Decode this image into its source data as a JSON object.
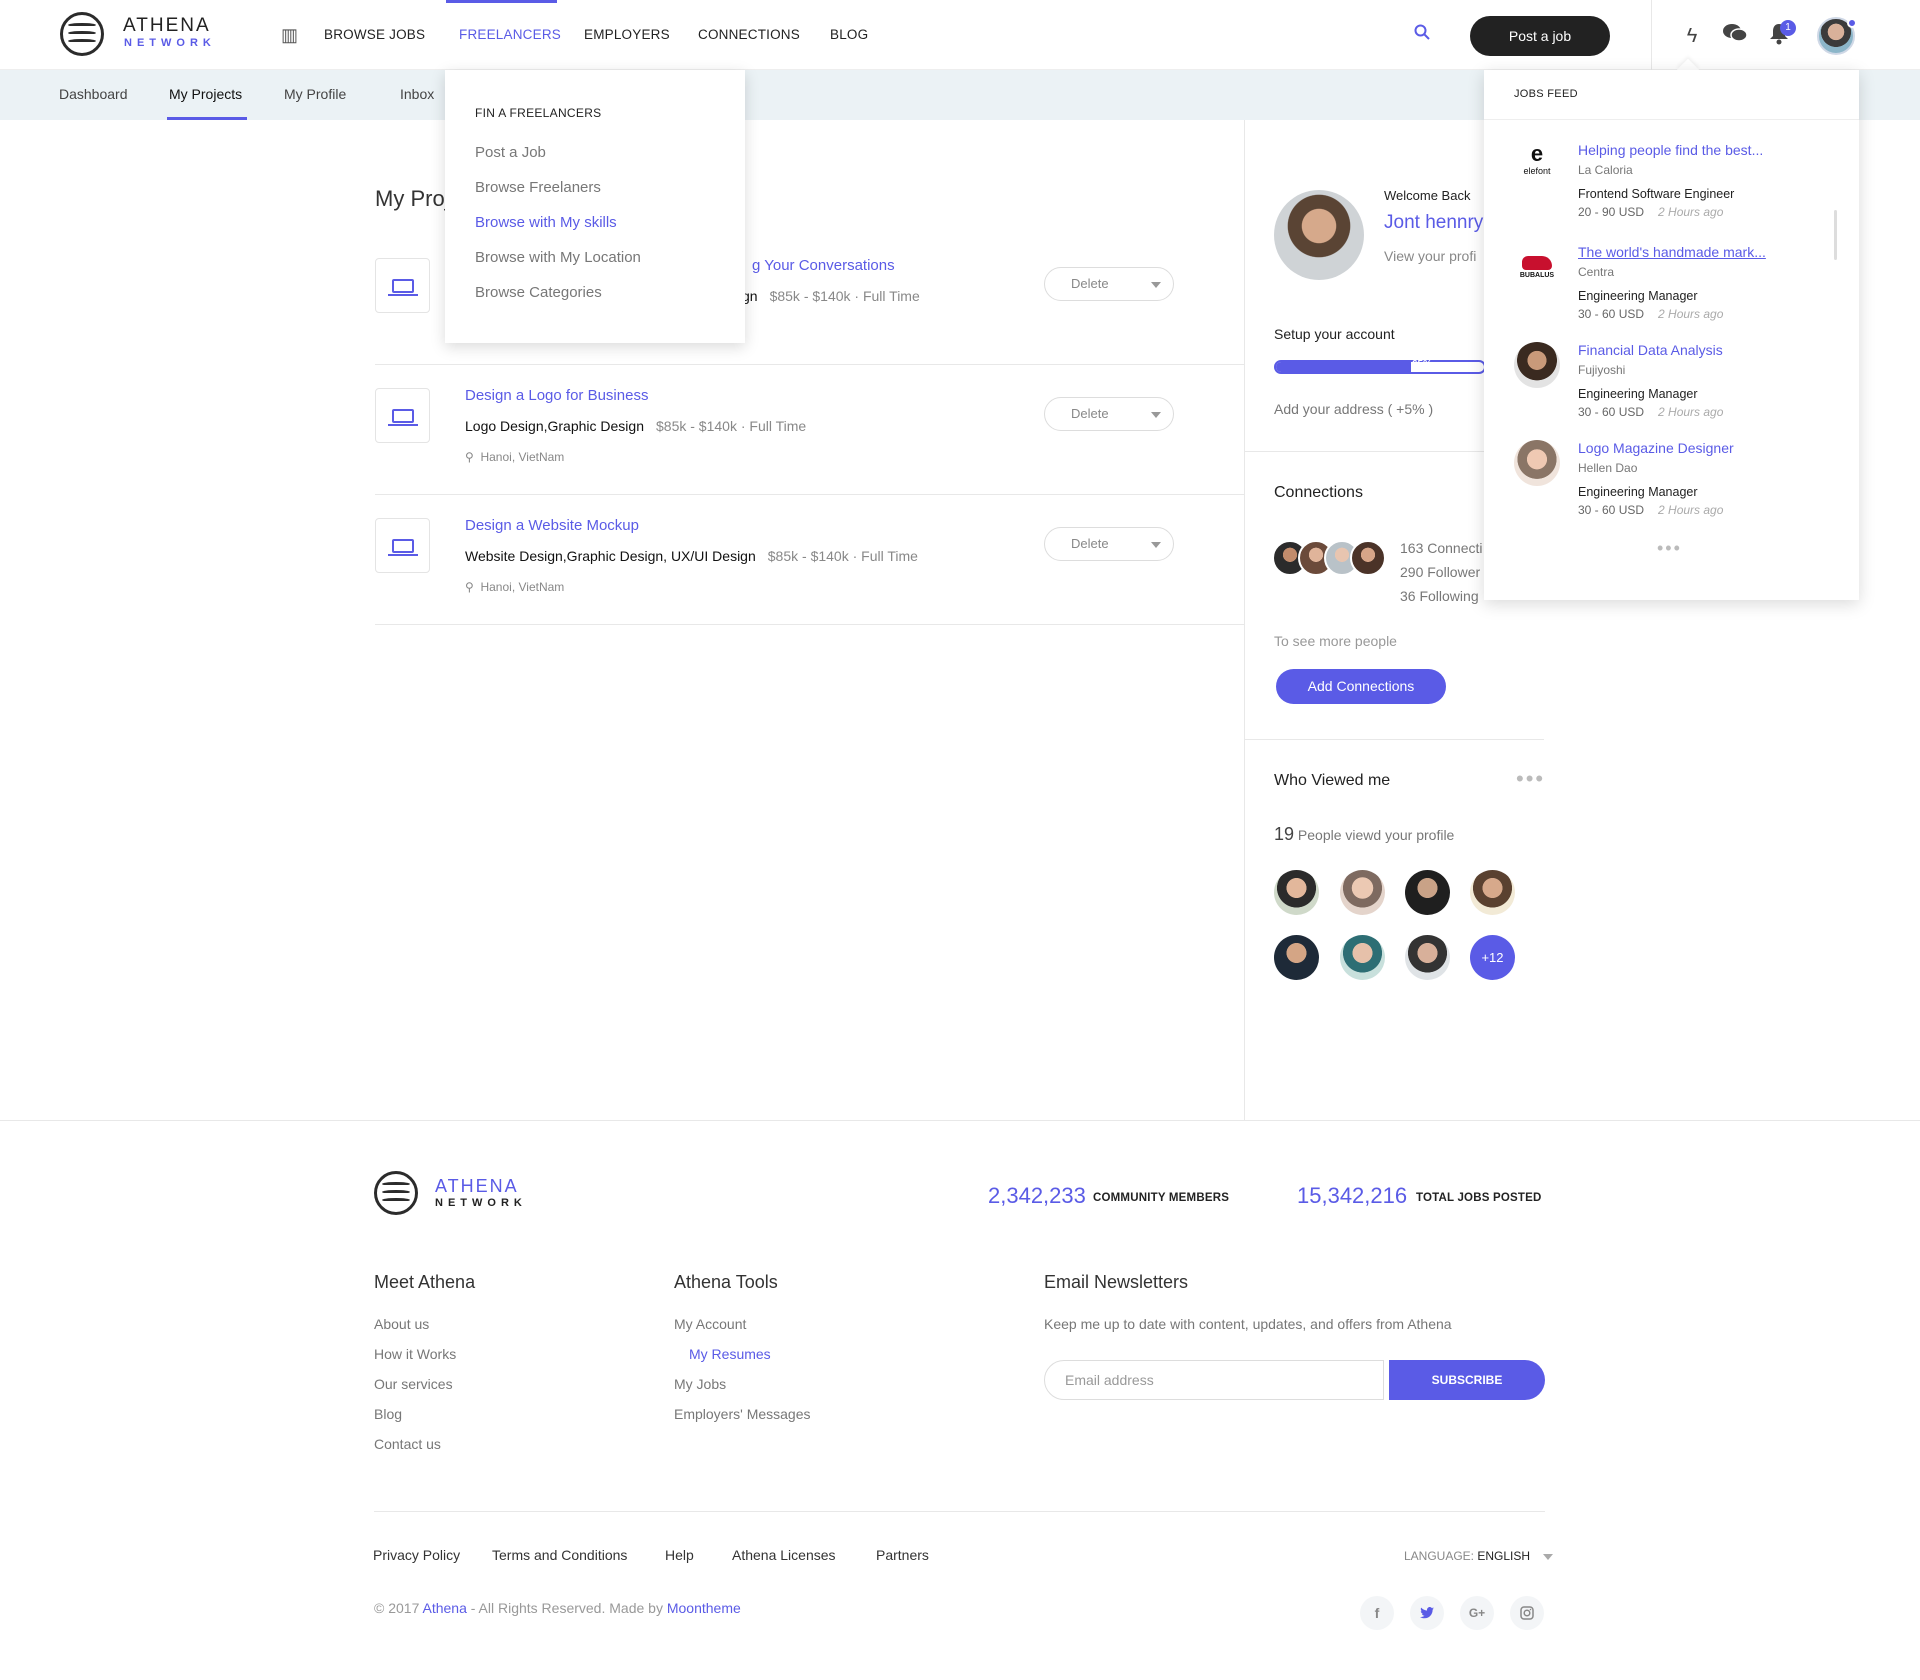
{
  "brand": {
    "name": "ATHENA",
    "sub": "NETWORK"
  },
  "nav": {
    "browse_jobs": "BROWSE JOBS",
    "freelancers": "FREELANCERS",
    "employers": "EMPLOYERS",
    "connections": "CONNECTIONS",
    "blog": "BLOG",
    "post_job": "Post a job",
    "notification_count": "1"
  },
  "subnav": [
    "Dashboard",
    "My Projects",
    "My Profile",
    "Inbox"
  ],
  "dropdown": {
    "heading": "FIN A FREELANCERS",
    "items": [
      "Post a Job",
      "Browse Freelaners",
      "Browse with My skills",
      "Browse with My Location",
      "Browse Categories"
    ]
  },
  "main": {
    "title": "My Proj",
    "delete_label": "Delete",
    "projects": [
      {
        "title": "g Your Conversations",
        "skills": "gn",
        "meta": "$85k - $140k · Full Time",
        "location": ""
      },
      {
        "title": "Design a Logo for Business",
        "skills": "Logo Design,Graphic Design",
        "meta": "$85k - $140k · Full Time",
        "location": "Hanoi, VietNam"
      },
      {
        "title": "Design a Website Mockup",
        "skills": "Website Design,Graphic Design, UX/UI Design",
        "meta": "$85k - $140k · Full Time",
        "location": "Hanoi, VietNam"
      }
    ]
  },
  "sidebar": {
    "welcome": "Welcome Back",
    "name": "Jont hennry",
    "view_profile": "View your profi",
    "setup": "Setup your account",
    "progress": 65,
    "progress_label": "65%",
    "add_address": "Add your address ( +5% )",
    "connections_title": "Connections",
    "connections": "163 Connecti",
    "followers": "290 Follower",
    "following": "36 Following",
    "see_more": "To see more people",
    "add_connections": "Add Connections",
    "viewed_title": "Who Viewed me",
    "viewed_count": "19",
    "viewed_text": "People viewd your profile",
    "viewed_more": "+12"
  },
  "feed": {
    "heading": "JOBS FEED",
    "items": [
      {
        "title": "Helping people find the best...",
        "company": "La Caloria",
        "role": "Frontend Software Engineer",
        "pay": "20 - 90 USD",
        "time": "2 Hours ago",
        "logo": "elefont"
      },
      {
        "title": "The world's handmade mark...",
        "company": "Centra",
        "role": "Engineering Manager",
        "pay": "30 - 60 USD",
        "time": "2 Hours ago",
        "logo": "BUBALUS"
      },
      {
        "title": "Financial Data Analysis",
        "company": "Fujiyoshi",
        "role": "Engineering Manager",
        "pay": "30 - 60 USD",
        "time": "2 Hours ago",
        "logo": ""
      },
      {
        "title": "Logo Magazine Designer",
        "company": "Hellen Dao",
        "role": "Engineering Manager",
        "pay": "30 - 60 USD",
        "time": "2 Hours ago",
        "logo": ""
      }
    ]
  },
  "footer": {
    "members_num": "2,342,233",
    "members_label": "COMMUNITY MEMBERS",
    "jobs_num": "15,342,216",
    "jobs_label": "TOTAL JOBS POSTED",
    "meet_title": "Meet Athena",
    "meet_links": [
      "About us",
      "How it Works",
      "Our services",
      "Blog",
      "Contact us"
    ],
    "tools_title": "Athena Tools",
    "tools_links": [
      "My Account",
      "My Resumes",
      "My Jobs",
      "Employers' Messages"
    ],
    "news_title": "Email Newsletters",
    "news_text": "Keep me up to date with content, updates, and offers from Athena",
    "email_placeholder": "Email address",
    "subscribe": "SUBSCRIBE",
    "bottom_links": [
      "Privacy Policy",
      "Terms and Conditions",
      "Help",
      "Athena Licenses",
      "Partners"
    ],
    "language_label": "LANGUAGE:",
    "language_value": "ENGLISH",
    "copyright_pre": "© 2017",
    "copyright_brand": "Athena",
    "copyright_mid": "- All Rights Reserved. Made by",
    "copyright_maker": "Moontheme"
  },
  "colors": {
    "accent": "#5a5be6",
    "dark": "#222222",
    "subnav_bg": "#ebf2f5"
  }
}
